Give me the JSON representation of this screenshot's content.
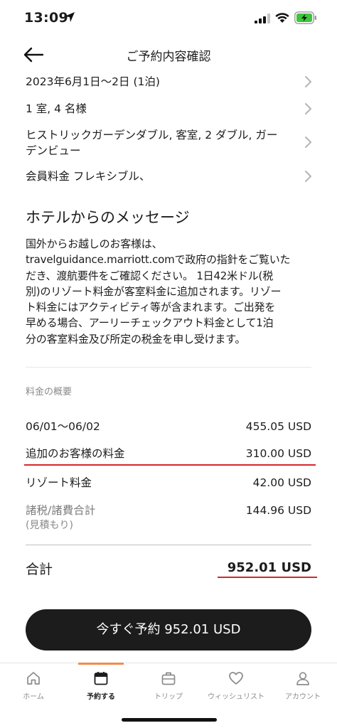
{
  "status_bar": {
    "time": "13:09"
  },
  "nav": {
    "title": "ご予約内容確認"
  },
  "booking": {
    "dates": "2023年6月1日～2日 (1泊)",
    "guests": "1 室, 4 名様",
    "room_line1": "ヒストリックガーデンダブル, 客室, 2 ダブル, ガー",
    "room_line2": "デンビュー",
    "rate": "会員料金 フレキシブル、"
  },
  "hotel_message": {
    "title": "ホテルからのメッセージ",
    "lines": [
      "国外からお越しのお客様は、",
      "travelguidance.marriott.comで政府の指針をご覧いた",
      "だき、渡航要件をご確認ください。 1日42米ドル(税",
      "別)のリゾート料金が客室料金に追加されます。リゾー",
      "ト料金にはアクティビティ等が含まれます。ご出発を",
      "早める場合、アーリーチェックアウト料金として1泊",
      "分の客室料金及び所定の税金を申し受けます。"
    ]
  },
  "summary": {
    "label": "料金の概要",
    "rows": [
      {
        "label": "06/01～06/02",
        "value": "455.05 USD"
      },
      {
        "label": "追加のお客様の料金",
        "value": "310.00 USD"
      },
      {
        "label": "リゾート料金",
        "value": "42.00 USD"
      },
      {
        "label": "諸税/諸費合計",
        "sublabel": "(見積もり)",
        "value": "144.96 USD"
      }
    ],
    "total_label": "合計",
    "total_value": "952.01 USD"
  },
  "cta": {
    "label": "今すぐ予約 952.01 USD"
  },
  "tabs": [
    {
      "label": "ホーム",
      "icon": "home-icon"
    },
    {
      "label": "予約する",
      "icon": "calendar-icon",
      "active": true
    },
    {
      "label": "トリップ",
      "icon": "suitcase-icon"
    },
    {
      "label": "ウィッシュリスト",
      "icon": "heart-icon"
    },
    {
      "label": "アカウント",
      "icon": "person-icon"
    }
  ],
  "colors": {
    "accent_underline": "#d9262a",
    "tab_indicator": "#f08d4c",
    "cta_background": "#1c1c1c",
    "battery": "#3ec43c"
  }
}
